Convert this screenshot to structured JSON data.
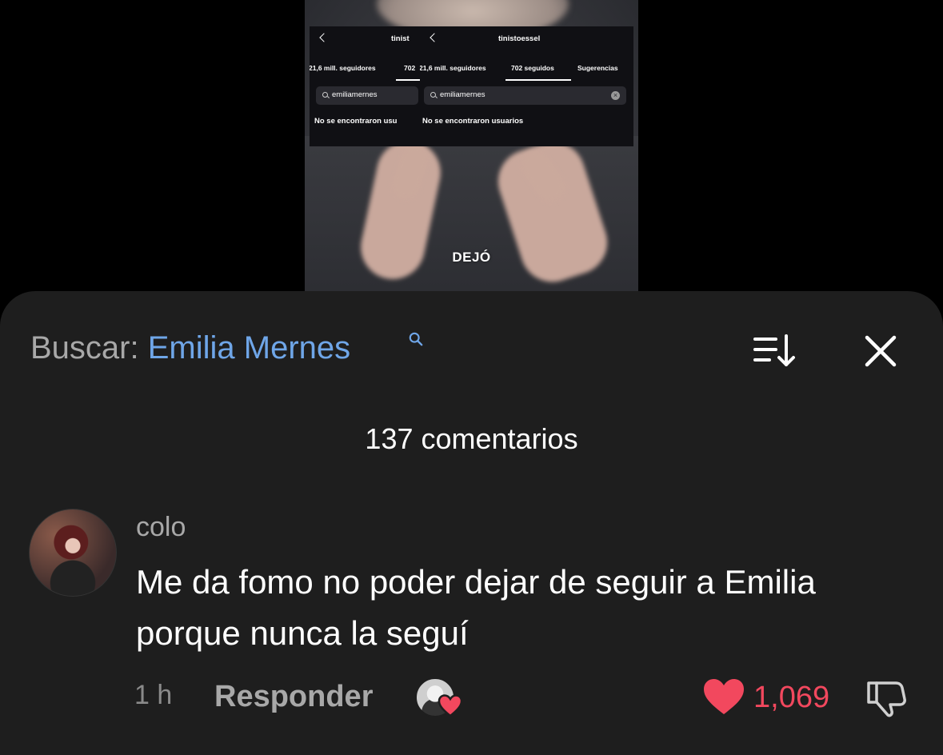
{
  "video": {
    "caption": "DEJÓ",
    "overlay": {
      "left_username": "tinist",
      "right_username": "tinistoessel",
      "left_tab_followers": "21,6 mill. seguidores",
      "left_tab_following": "702",
      "right_tab_followers": "21,6 mill. seguidores",
      "right_tab_following": "702 seguidos",
      "right_tab_suggestions": "Sugerencias",
      "left_search_value": "emiliamernes",
      "right_search_value": "emiliamernes",
      "left_empty_text": "No se encontraron usu",
      "right_empty_text": "No se encontraron usuarios"
    }
  },
  "header": {
    "search_prefix": "Buscar:",
    "search_term": "Emilia Mernes",
    "search_icon": "search-icon",
    "sort_icon": "sort-icon",
    "close_icon": "close-icon"
  },
  "comments_count": "137 comentarios",
  "comment": {
    "author": "colo",
    "text": "Me da fomo no poder dejar de seguir a Emilia porque nunca la seguí",
    "time": "1 h",
    "reply_label": "Responder",
    "likes": "1,069",
    "like_color": "#f2485e",
    "creator_liked_icon": "heart-icon",
    "dislike_icon": "thumbs-down-icon"
  },
  "colors": {
    "accent": "#6fa6e8",
    "sheet_bg": "#1e1e1e"
  }
}
